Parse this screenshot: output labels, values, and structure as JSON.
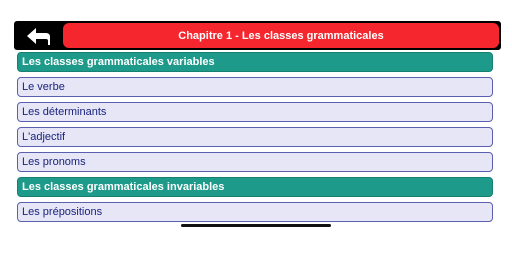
{
  "header": {
    "title": "Chapitre 1 - Les classes grammaticales",
    "back_icon": "arrow-left-icon",
    "colors": {
      "bar": "#000000",
      "title_bg": "#f5262e",
      "title_text": "#ffffff"
    }
  },
  "list": {
    "colors": {
      "section_bg": "#1e9a8a",
      "item_bg": "#e6e6f6",
      "item_border": "#5a5fb0",
      "item_text": "#1a237e"
    },
    "rows": [
      {
        "type": "section",
        "label": "Les classes grammaticales variables"
      },
      {
        "type": "item",
        "label": "Le verbe"
      },
      {
        "type": "item",
        "label": "Les déterminants"
      },
      {
        "type": "item",
        "label": "L'adjectif"
      },
      {
        "type": "item",
        "label": "Les pronoms"
      },
      {
        "type": "section",
        "label": "Les classes grammaticales invariables"
      },
      {
        "type": "item",
        "label": "Les prépositions"
      }
    ]
  }
}
